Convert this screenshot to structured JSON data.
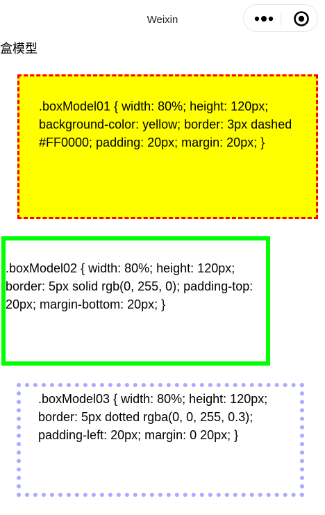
{
  "nav": {
    "title": "Weixin"
  },
  "page": {
    "heading": "盒模型"
  },
  "boxes": [
    {
      "text": ".boxModel01 { width: 80%; height: 120px; background-color: yellow; border: 3px dashed #FF0000; padding: 20px; margin: 20px; }",
      "background_color": "#ffff00",
      "border_color": "#ff0000"
    },
    {
      "text": ".boxModel02 { width: 80%; height: 120px; border: 5px solid rgb(0, 255, 0); padding-top: 20px; margin-bottom: 20px; }",
      "border_color": "#00ff00"
    },
    {
      "text": ".boxModel03 { width: 80%; height: 120px; border: 5px dotted rgba(0, 0, 255, 0.3); padding-left: 20px; margin: 0 20px; }",
      "border_color": "#aaaaff"
    }
  ],
  "icons": {
    "more": "more-dots-icon",
    "close": "capsule-close-icon"
  }
}
